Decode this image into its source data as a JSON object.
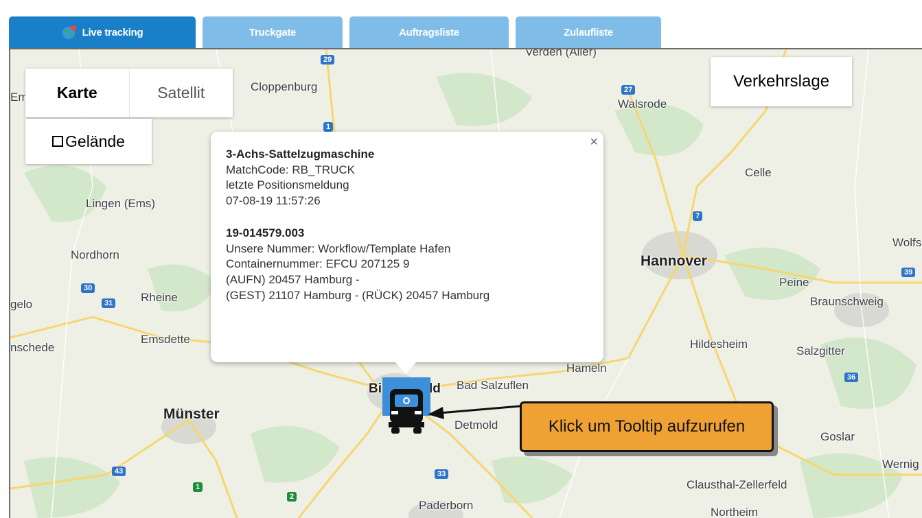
{
  "tabs": [
    {
      "label": "Live tracking",
      "active": true
    },
    {
      "label": "Truckgate",
      "active": false
    },
    {
      "label": "Auftragsliste",
      "active": false
    },
    {
      "label": "Zulaufliste",
      "active": false
    }
  ],
  "map_controls": {
    "map_label": "Karte",
    "satellite_label": "Satellit",
    "terrain_label": "Gelände",
    "traffic_label": "Verkehrslage"
  },
  "map_labels": [
    "Cloppenburg",
    "Walsrode",
    "Celle",
    "Lingen (Ems)",
    "Nordhorn",
    "Hannover",
    "Rheine",
    "Emsdette",
    "Peine",
    "Braunschweig",
    "Hildesheim",
    "Salzgitter",
    "Hameln",
    "Bad Salzuflen",
    "Münster",
    "Detmold",
    "Goslar",
    "Clausthal-Zellerfeld",
    "Paderborn",
    "Northeim",
    "Verden (Aller)",
    "Wolfs",
    "Wernig",
    "gelo",
    "nschede",
    "Em",
    "Bi",
    "ld"
  ],
  "road_shields": [
    "29",
    "27",
    "1",
    "7",
    "30",
    "31",
    "39",
    "36",
    "33",
    "43",
    "1",
    "2"
  ],
  "info_window": {
    "title": "3-Achs-Sattelzugmaschine",
    "matchcode": "MatchCode: RB_TRUCK",
    "position_label": "letzte Positionsmeldung",
    "timestamp": "07-08-19 11:57:26",
    "order_number": "19-014579.003",
    "our_number": "Unsere Nummer: Workflow/Template Hafen",
    "container": "Containernummer: EFCU 207125 9",
    "line_aufn": "(AUFN) 20457 Hamburg -",
    "line_gest": "(GEST) 21107 Hamburg - (RÜCK) 20457 Hamburg",
    "close_symbol": "×"
  },
  "callout": {
    "text": "Klick um Tooltip aufzurufen"
  },
  "colors": {
    "tab_active": "#1a7fc9",
    "tab_inactive": "#7fbde8",
    "callout": "#f0a133",
    "marker": "#3d8fda"
  },
  "icons": [
    "globe-icon",
    "truck-icon",
    "close-icon",
    "checkbox-icon",
    "arrow-icon"
  ]
}
